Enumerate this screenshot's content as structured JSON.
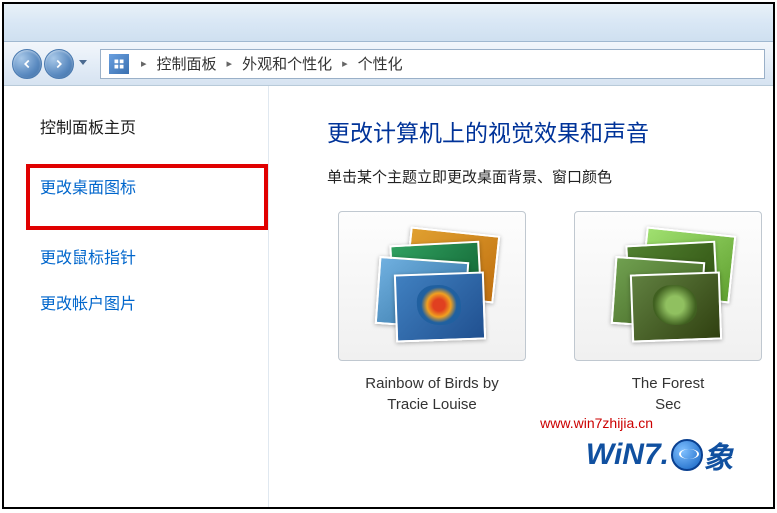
{
  "breadcrumb": {
    "items": [
      "控制面板",
      "外观和个性化",
      "个性化"
    ]
  },
  "sidebar": {
    "home": "控制面板主页",
    "links": [
      "更改桌面图标",
      "更改鼠标指针",
      "更改帐户图片"
    ]
  },
  "main": {
    "title": "更改计算机上的视觉效果和声音",
    "subtitle": "单击某个主题立即更改桌面背景、窗口颜色"
  },
  "themes": [
    {
      "name_line1": "Rainbow of Birds by",
      "name_line2": "Tracie Louise"
    },
    {
      "name_line1": "The Forest",
      "name_line2": "Sec"
    }
  ],
  "watermark": {
    "url": "www.win7zhijia.cn",
    "logo_text": "WiN7.",
    "logo_suffix": "象"
  }
}
